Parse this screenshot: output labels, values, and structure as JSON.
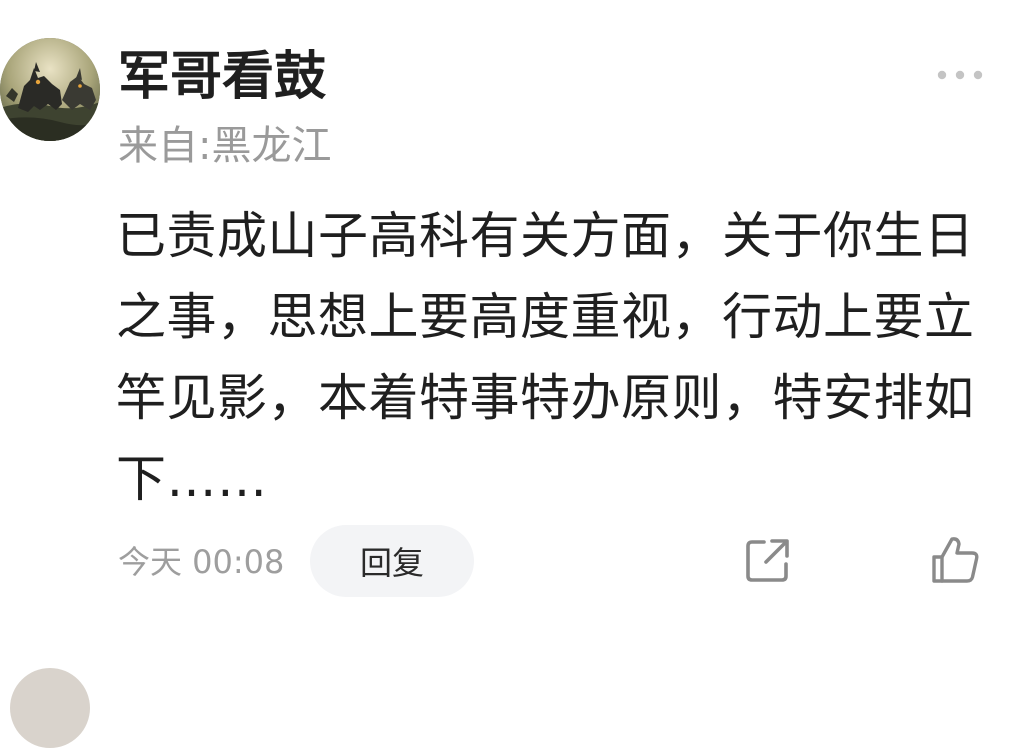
{
  "comment": {
    "author": "军哥看鼓",
    "location": "来自:黑龙江",
    "text": "已责成山子高科有关方面，关于你生日之事，思想上要高度重视，行动上要立竿见影，本着特事特办原则，特安排如下……",
    "timestamp": "今天 00:08",
    "reply_label": "回复"
  },
  "icons": {
    "avatar": "wolf-avatar",
    "more": "more-dots-icon",
    "share": "share-icon",
    "like": "thumbs-up-icon"
  },
  "colors": {
    "secondary_text": "#9a9a9a",
    "reply_bg": "#f3f4f6",
    "icon": "#8a8a8a"
  }
}
